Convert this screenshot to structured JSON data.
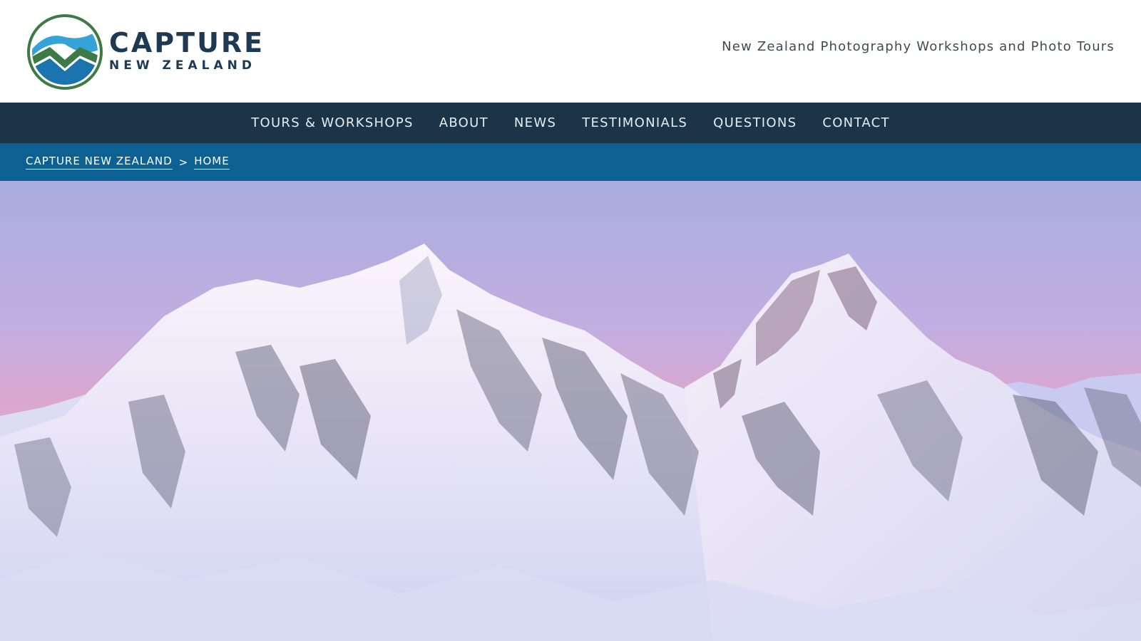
{
  "site": {
    "name": "CAPTURE",
    "subname": "NEW ZEALAND",
    "tagline": "New Zealand Photography Workshops and Photo Tours",
    "colors": {
      "header_bg": "#ffffff",
      "nav_bg": "#1c3448",
      "breadcrumb_bg": "#0c6192",
      "brand_text": "#1d3a52",
      "logo_green": "#3e7a45",
      "logo_blue": "#2a8fc4"
    }
  },
  "nav": {
    "items": [
      {
        "label": "TOURS & WORKSHOPS"
      },
      {
        "label": "ABOUT"
      },
      {
        "label": "NEWS"
      },
      {
        "label": "TESTIMONIALS"
      },
      {
        "label": "QUESTIONS"
      },
      {
        "label": "CONTACT"
      }
    ]
  },
  "breadcrumb": {
    "items": [
      {
        "label": "CAPTURE NEW ZEALAND"
      },
      {
        "label": "HOME"
      }
    ],
    "separator": ">"
  },
  "hero": {
    "icon": "snowy-mountain-peaks-image"
  }
}
